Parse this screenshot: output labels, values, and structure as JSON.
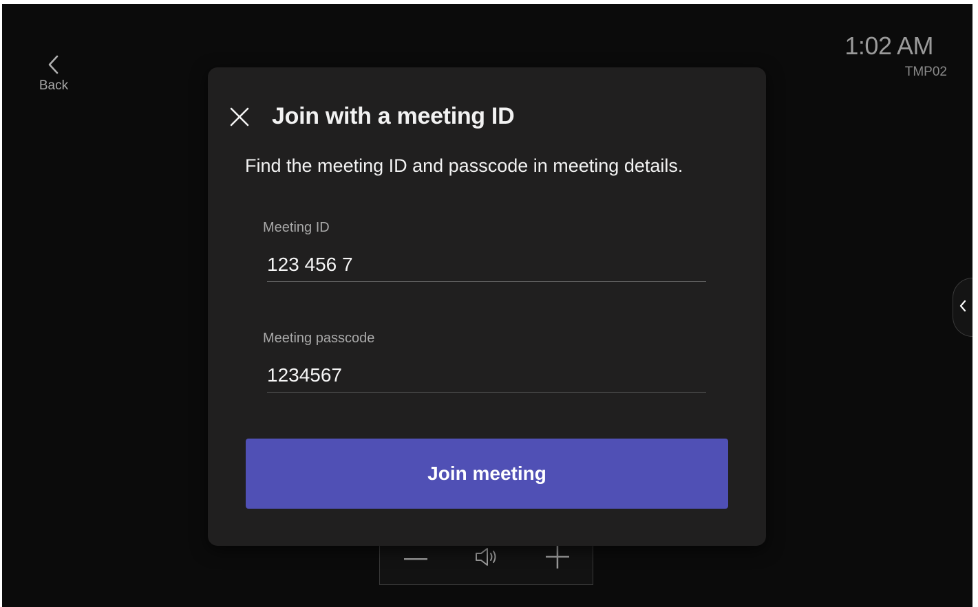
{
  "header": {
    "back_label": "Back",
    "clock": "1:02 AM",
    "device_name": "TMP02"
  },
  "dialog": {
    "title": "Join with a meeting ID",
    "subtitle": "Find the meeting ID and passcode in meeting details.",
    "meeting_id": {
      "label": "Meeting ID",
      "value": "123 456 7"
    },
    "passcode": {
      "label": "Meeting passcode",
      "value": "1234567"
    },
    "join_label": "Join meeting"
  },
  "volume_controls": {
    "icons": [
      "minus-icon",
      "speaker-icon",
      "plus-icon"
    ]
  },
  "colors": {
    "background": "#0b0b0b",
    "dialog": "#201f1f",
    "accent": "#5050b5"
  }
}
